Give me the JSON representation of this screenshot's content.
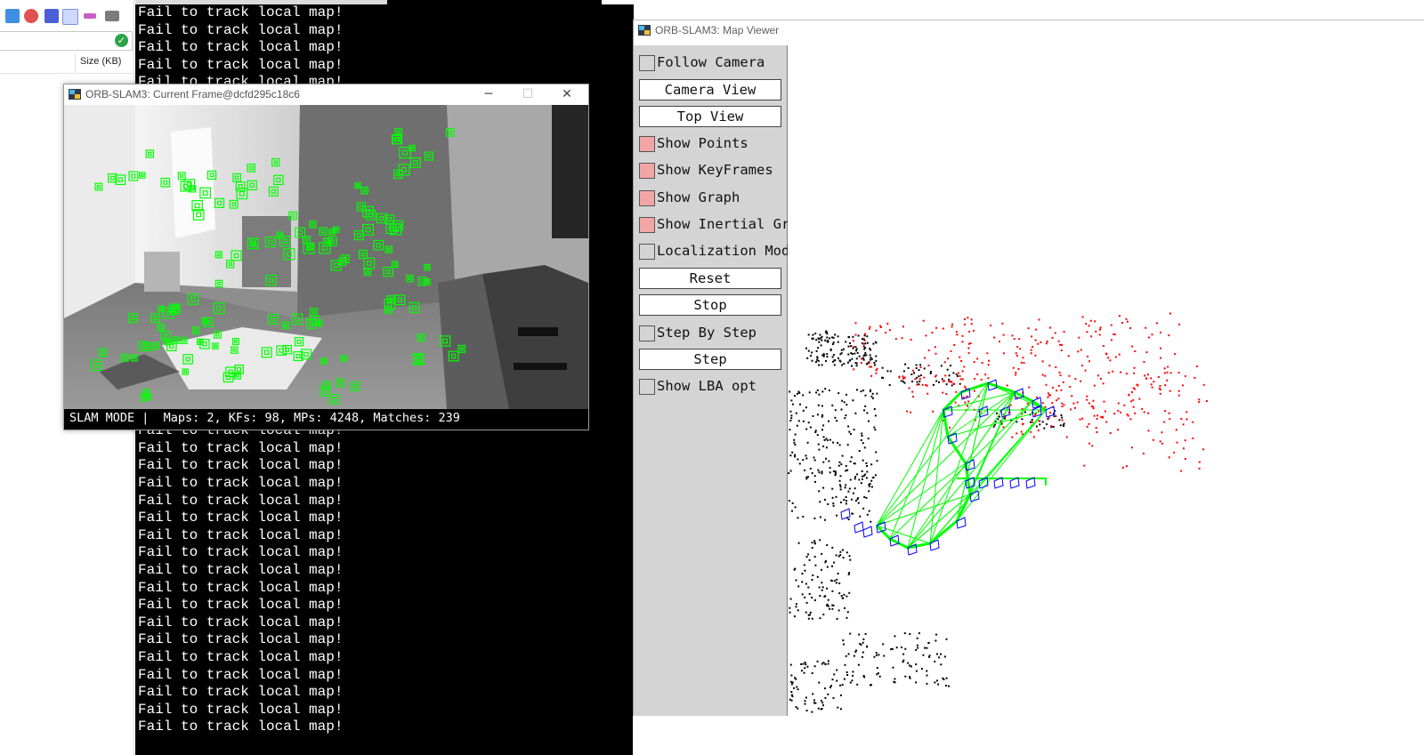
{
  "explorer": {
    "size_column": "Size (KB)",
    "toolbar_icons": [
      "file-icon",
      "delete-icon",
      "rename-icon",
      "properties-icon",
      "tools-icon",
      "terminal-icon"
    ],
    "status_icon": "checkmark-icon"
  },
  "console": {
    "lines": [
      "Fail to track local map!",
      "Fail to track local map!",
      "Fail to track local map!",
      "Fail to track local map!",
      "Fail to track local map!",
      "Fail to track local map!",
      "Fail to track local map!",
      "Fail to track local map!",
      "Fail to track local map!",
      "Fail to track local map!",
      "Fail to track local map!",
      "Fail to track local map!",
      "Fail to track local map!",
      "Fail to track local map!",
      "Fail to track local map!",
      "Fail to track local map!",
      "Fail to track local map!",
      "Fail to track local map!",
      "Fail to track local map!",
      "Fail to track local map!",
      "Fail to track local map!",
      "Fail to track local map!",
      "Fail to track local map!",
      "Fail to track local map!",
      "Fail to track local map!",
      "Fail to track local map!",
      "Fail to track local map!",
      "Fail to track local map!",
      "Fail to track local map!",
      "Fail to track local map!",
      "Fail to track local map!",
      "Fail to track local map!",
      "Fail to track local map!",
      "Fail to track local map!",
      "Fail to track local map!",
      "Fail to track local map!",
      "Fail to track local map!",
      "Fail to track local map!",
      "Fail to track local map!",
      "Fail to track local map!",
      "Fail to track local map!",
      "Fail to track local map!"
    ]
  },
  "frame_window": {
    "title": "ORB-SLAM3: Current Frame@dcfd295c18c6",
    "minimize": "─",
    "maximize": "☐",
    "close": "✕",
    "status": "SLAM MODE |  Maps: 2, KFs: 98, MPs: 4248, Matches: 239",
    "feature_color": "#00ff00"
  },
  "map_window": {
    "title": "ORB-SLAM3: Map Viewer",
    "controls": {
      "follow_camera": {
        "label": "Follow Camera",
        "checked": false
      },
      "camera_view": "Camera View",
      "top_view": "Top View",
      "show_points": {
        "label": "Show Points",
        "checked": true
      },
      "show_keyframes": {
        "label": "Show KeyFrames",
        "checked": true
      },
      "show_graph": {
        "label": "Show Graph",
        "checked": true
      },
      "show_inertial_graph": {
        "label": "Show Inertial Graph",
        "checked": true
      },
      "localization_mode": {
        "label": "Localization Mode",
        "checked": false
      },
      "reset": "Reset",
      "stop": "Stop",
      "step_by_step": {
        "label": "Step By Step",
        "checked": false
      },
      "step": "Step",
      "show_lba_opt": {
        "label": "Show LBA opt",
        "checked": false
      }
    },
    "colors": {
      "map_points": "#000000",
      "local_points": "#ff0000",
      "keyframes": "#0000ff",
      "graph": "#00ff00",
      "checkbox_on": "#f3a5a5"
    }
  }
}
